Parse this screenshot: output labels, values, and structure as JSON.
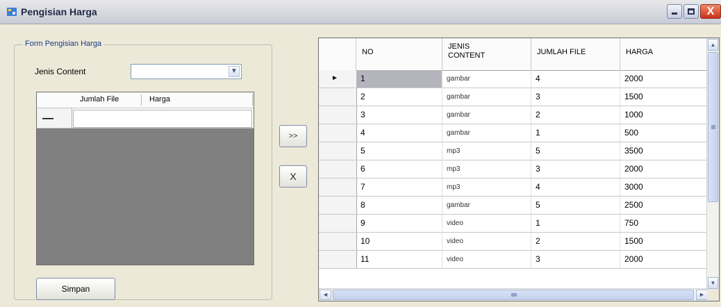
{
  "window": {
    "title": "Pengisian Harga",
    "controls": {
      "minimize": "_",
      "maximize": "□",
      "close": "X"
    }
  },
  "form": {
    "group_title": "Form Pengisian Harga",
    "jenis_label": "Jenis Content",
    "combo_value": "",
    "grid": {
      "columns": [
        "Jumlah File",
        "Harga"
      ],
      "new_row_marker": "—"
    },
    "save_button": "Simpan",
    "add_button": ">>",
    "delete_button": "X"
  },
  "table": {
    "headers": [
      "NO",
      "JENIS CONTENT",
      "JUMLAH FILE",
      "HARGA"
    ],
    "current_row_marker": "►",
    "selected_row": 0,
    "rows": [
      {
        "no": "1",
        "jenis": "gambar",
        "jumlah": "4",
        "harga": "2000"
      },
      {
        "no": "2",
        "jenis": "gambar",
        "jumlah": "3",
        "harga": "1500"
      },
      {
        "no": "3",
        "jenis": "gambar",
        "jumlah": "2",
        "harga": "1000"
      },
      {
        "no": "4",
        "jenis": "gambar",
        "jumlah": "1",
        "harga": "500"
      },
      {
        "no": "5",
        "jenis": "mp3",
        "jumlah": "5",
        "harga": "3500"
      },
      {
        "no": "6",
        "jenis": "mp3",
        "jumlah": "3",
        "harga": "2000"
      },
      {
        "no": "7",
        "jenis": "mp3",
        "jumlah": "4",
        "harga": "3000"
      },
      {
        "no": "8",
        "jenis": "gambar",
        "jumlah": "5",
        "harga": "2500"
      },
      {
        "no": "9",
        "jenis": "video",
        "jumlah": "1",
        "harga": "750"
      },
      {
        "no": "10",
        "jenis": "video",
        "jumlah": "2",
        "harga": "1500"
      },
      {
        "no": "11",
        "jenis": "video",
        "jumlah": "3",
        "harga": "2000"
      }
    ]
  },
  "colors": {
    "selected_cell": "#b4b4bc",
    "grid_background": "#808080",
    "legend_text": "#1b3a8a"
  }
}
